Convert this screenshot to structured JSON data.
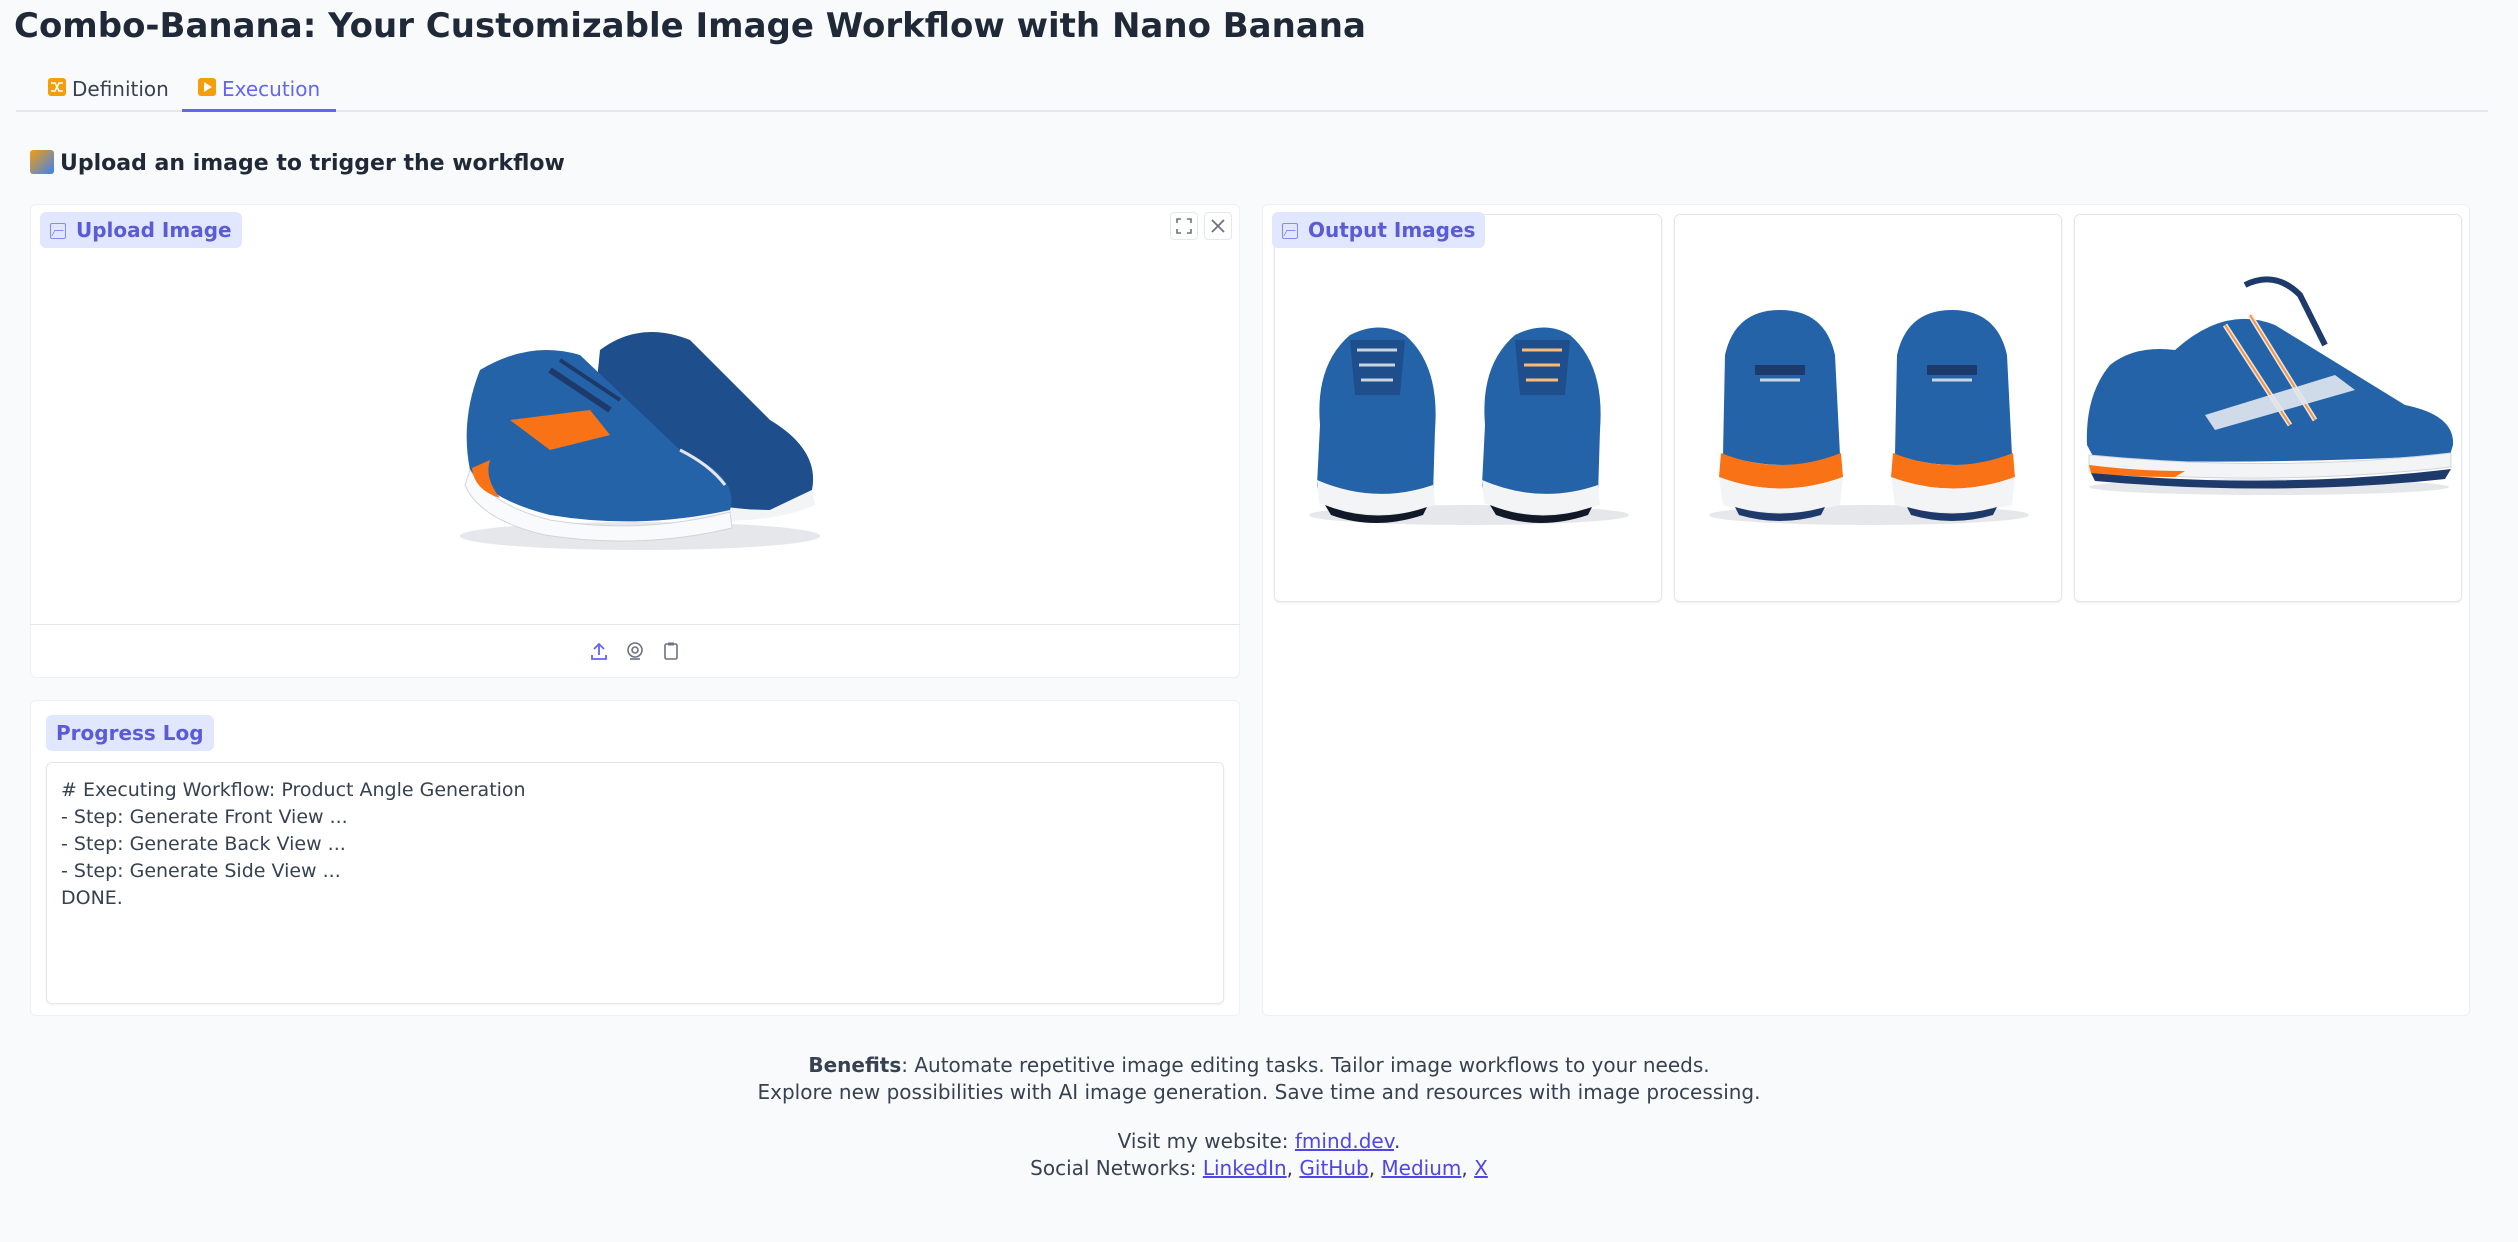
{
  "app": {
    "title": "Combo-Banana: Your Customizable Image Workflow with Nano Banana"
  },
  "tabs": [
    {
      "label": "Definition",
      "icon": "shuffle-icon",
      "active": false,
      "icon_color": "#f59e0b"
    },
    {
      "label": "Execution",
      "icon": "play-icon",
      "active": true,
      "icon_color": "#f59e0b"
    }
  ],
  "section": {
    "heading": "Upload an image to trigger the workflow",
    "icon": "framed-picture-icon"
  },
  "upload": {
    "label": "Upload Image",
    "toolbar": [
      "upload-icon",
      "webcam-icon",
      "clipboard-icon"
    ]
  },
  "progress": {
    "label": "Progress Log",
    "lines": [
      "# Executing Workflow: Product Angle Generation",
      "- Step: Generate Front View ...",
      "- Step: Generate Back View ...",
      "- Step: Generate Side View ...",
      "DONE."
    ]
  },
  "output": {
    "label": "Output Images",
    "images": [
      "front-view-shoes",
      "back-view-shoes",
      "side-view-shoe"
    ]
  },
  "footer": {
    "benefits_label": "Benefits",
    "benefits_text_1": ": Automate repetitive image editing tasks. Tailor image workflows to your needs.",
    "benefits_text_2": "Explore new possibilities with AI image generation. Save time and resources with image processing.",
    "visit_prefix": "Visit my website: ",
    "website_link": "fmind.dev",
    "visit_suffix": ".",
    "social_prefix": "Social Networks: ",
    "social_links": [
      "LinkedIn",
      "GitHub",
      "Medium",
      "X"
    ],
    "sep": ", "
  },
  "colors": {
    "accent": "#6366f1",
    "shoe_blue": "#2563a8",
    "shoe_orange": "#f97316"
  }
}
